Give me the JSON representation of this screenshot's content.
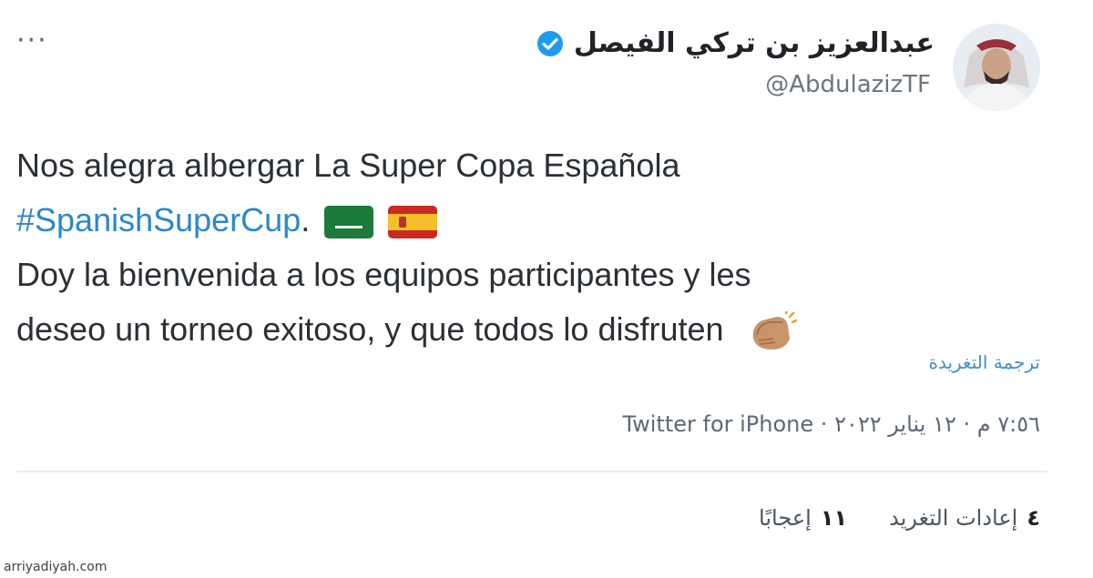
{
  "header": {
    "display_name": "عبدالعزيز بن تركي الفيصل",
    "handle": "@AbdulazizTF",
    "more_glyph": "···"
  },
  "tweet": {
    "line1": "Nos alegra albergar La Super Copa Española",
    "hashtag": "#SpanishSuperCup",
    "after_hashtag": ".",
    "line3": "Doy la bienvenida a los equipos participantes y les",
    "line4": "deseo un torneo exitoso, y que todos lo disfruten"
  },
  "translate_label": "ترجمة التغريدة",
  "meta": {
    "time": "٧:٥٦ م",
    "date": "١٢ يناير ٢٠٢٢",
    "source": "Twitter for iPhone"
  },
  "stats": {
    "retweets_label": "إعادات التغريد",
    "retweets_count": "٤",
    "likes_label": "إعجابًا",
    "likes_count": "١١"
  },
  "watermark": "arriyadiyah.com",
  "colors": {
    "link": "#2b88c7",
    "verified": "#1d9bf0",
    "text": "#2b3035"
  }
}
